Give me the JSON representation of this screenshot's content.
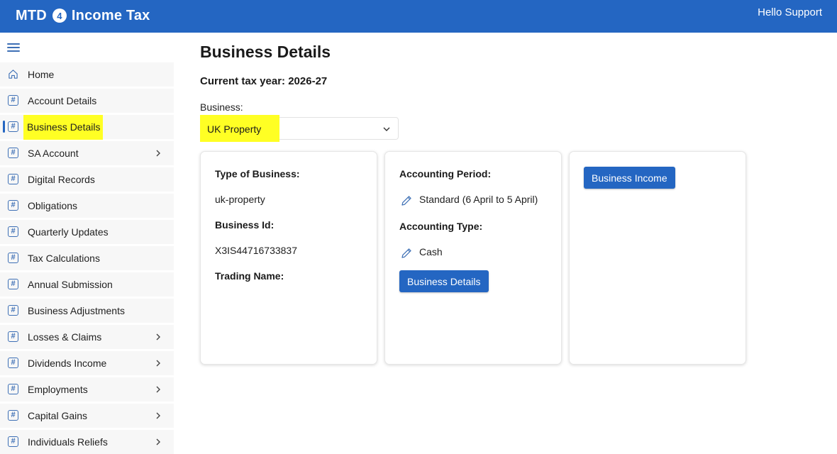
{
  "header": {
    "brand_left": "MTD",
    "brand_badge": "4",
    "brand_right": "Income Tax",
    "greeting": "Hello Support",
    "bar_color": "#2466c2"
  },
  "sidebar": {
    "menu_icon": "hamburger-icon",
    "items": [
      {
        "label": "Home",
        "icon": "home-icon",
        "chevron": false
      },
      {
        "label": "Account Details",
        "icon": "hash-icon",
        "chevron": false
      },
      {
        "label": "Business Details",
        "icon": "hash-icon",
        "chevron": false,
        "active": true
      },
      {
        "label": "SA Account",
        "icon": "hash-icon",
        "chevron": true
      },
      {
        "label": "Digital Records",
        "icon": "hash-icon",
        "chevron": false
      },
      {
        "label": "Obligations",
        "icon": "hash-icon",
        "chevron": false
      },
      {
        "label": "Quarterly Updates",
        "icon": "hash-icon",
        "chevron": false
      },
      {
        "label": "Tax Calculations",
        "icon": "hash-icon",
        "chevron": false
      },
      {
        "label": "Annual Submission",
        "icon": "hash-icon",
        "chevron": false
      },
      {
        "label": "Business Adjustments",
        "icon": "hash-icon",
        "chevron": false
      },
      {
        "label": "Losses & Claims",
        "icon": "hash-icon",
        "chevron": true
      },
      {
        "label": "Dividends Income",
        "icon": "hash-icon",
        "chevron": true
      },
      {
        "label": "Employments",
        "icon": "hash-icon",
        "chevron": true
      },
      {
        "label": "Capital Gains",
        "icon": "hash-icon",
        "chevron": true
      },
      {
        "label": "Individuals Reliefs",
        "icon": "hash-icon",
        "chevron": true
      }
    ],
    "hash_glyph": "#"
  },
  "main": {
    "title": "Business Details",
    "tax_year": "Current tax year: 2026-27",
    "business_label": "Business:",
    "business_selected": "UK Property",
    "highlight_color": "#ffff24",
    "card1": {
      "type_label": "Type of Business:",
      "type_value": "uk-property",
      "id_label": "Business Id:",
      "id_value": "X3IS44716733837",
      "trading_label": "Trading Name:"
    },
    "card2": {
      "period_label": "Accounting Period:",
      "period_value": "Standard (6 April to 5 April)",
      "type_label": "Accounting Type:",
      "type_value": "Cash",
      "button": "Business Details"
    },
    "card3": {
      "button": "Business Income"
    }
  }
}
